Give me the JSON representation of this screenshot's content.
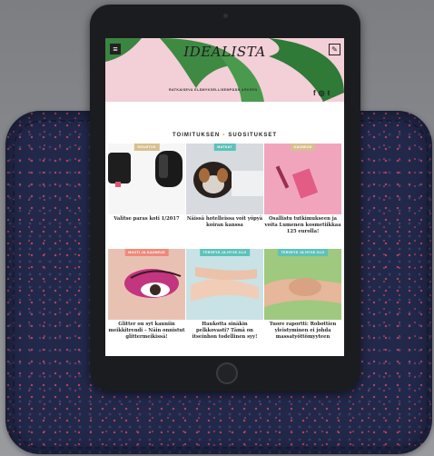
{
  "site": {
    "logo": "IDEALISTA",
    "tagline": "RATKAISEVA ELÄMYKSELLISEMPÄÄN ARKEEN",
    "menu_icon": "menu-icon",
    "edit_icon": "edit-icon",
    "social": [
      "f",
      "◎",
      "t"
    ]
  },
  "section": {
    "title_left": "TOIMITUKSEN",
    "title_right": "SUOSITUKSET",
    "separator": "•"
  },
  "colors": {
    "badge_gold": "#d9bf8f",
    "badge_teal": "#5bc3ba",
    "badge_coral": "#ef8a7b",
    "hero_pink": "#f3cfd8",
    "sleeve_navy": "#22284a"
  },
  "cards": [
    {
      "badge": "SISUSTUS",
      "badge_color": "#d9bf8f",
      "title": "Valitse paras koti 1/2017",
      "scene": "kitchen"
    },
    {
      "badge": "MATKAT",
      "badge_color": "#5bc3ba",
      "title": "Näissä hotelleissa voit yöpyä koiran kanssa",
      "scene": "dog"
    },
    {
      "badge": "KAUNEUS",
      "badge_color": "#d9bf8f",
      "title": "Osallistu tutkimukseen ja voita Lumenen kosmetiikkaa 125 eurolla!",
      "scene": "pink"
    },
    {
      "badge": "MUOTI JA KAUNEUS",
      "badge_color": "#ef8a7b",
      "title": "Glitter on syt kauniin meikkitrendi – Näin onnistut glittermeikissä!",
      "scene": "eye"
    },
    {
      "badge": "TERVEYS JA HYVÄ OLO",
      "badge_color": "#5bc3ba",
      "title": "Haukotta sinäkin pelkkovasti? Tämä on itseinhon todellinen syy!",
      "scene": "hands"
    },
    {
      "badge": "TERVEYS JA HYVÄ OLO",
      "badge_color": "#5bc3ba",
      "title": "Tuore raportti: Robottien yleistyminen ei johda massatyöttömyyteen",
      "scene": "hands2"
    }
  ]
}
